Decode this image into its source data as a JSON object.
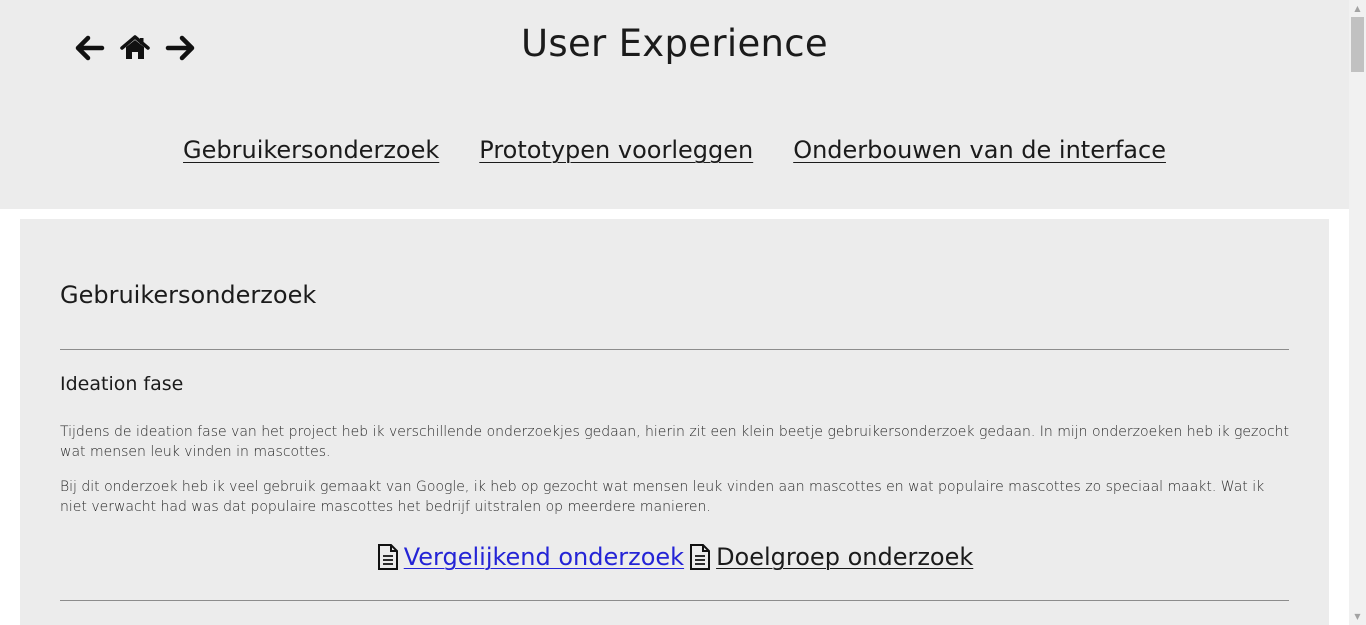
{
  "header": {
    "title": "User Experience",
    "nav_icons": [
      "back-arrow-icon",
      "home-icon",
      "forward-arrow-icon"
    ],
    "topics": [
      {
        "label": "Gebruikersonderzoek"
      },
      {
        "label": "Prototypen voorleggen"
      },
      {
        "label": "Onderbouwen van de interface"
      }
    ]
  },
  "main": {
    "section_title": "Gebruikersonderzoek",
    "sub_title": "Ideation fase",
    "paragraphs": [
      "Tijdens de ideation fase van het project heb ik verschillende onderzoekjes gedaan, hierin zit een klein beetje gebruikersonderzoek gedaan. In mijn onderzoeken heb ik gezocht wat mensen leuk vinden in mascottes.",
      "Bij dit onderzoek heb ik veel gebruik gemaakt van Google, ik heb op gezocht wat mensen leuk vinden aan mascottes en wat populaire mascottes zo speciaal maakt. Wat ik niet verwacht had was dat populaire mascottes het bedrijf uitstralen op meerdere manieren."
    ],
    "doc_links": [
      {
        "label": "Vergelijkend onderzoek",
        "icon": "document-icon",
        "color": "#2424d6"
      },
      {
        "label": "Doelgroep onderzoek",
        "icon": "document-icon",
        "color": "#1b1b1b"
      }
    ]
  },
  "colors": {
    "header_bg": "#ececec",
    "content_bg": "#ececec",
    "page_bg": "#ffffff",
    "text": "#1b1b1b",
    "visited_link": "#2424d6"
  }
}
